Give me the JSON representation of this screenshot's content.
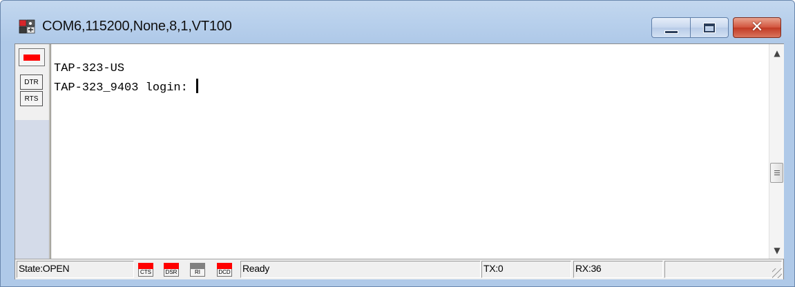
{
  "window": {
    "title": "COM6,115200,None,8,1,VT100",
    "icon": "serial-terminal-app-icon",
    "controls": {
      "minimize": "minimize-icon",
      "maximize": "maximize-icon",
      "close": "close-icon"
    }
  },
  "left_panel": {
    "lamp": {
      "color": "#ff0000"
    },
    "buttons": [
      "DTR",
      "RTS"
    ]
  },
  "terminal": {
    "lines": [
      "TAP-323-US",
      "TAP-323_9403 login: "
    ]
  },
  "status_bar": {
    "state": "State:OPEN",
    "indicators": [
      {
        "label": "CTS",
        "color": "#ff0000"
      },
      {
        "label": "DSR",
        "color": "#ff0000"
      },
      {
        "label": "RI",
        "color": "#808080"
      },
      {
        "label": "DCD",
        "color": "#ff0000"
      }
    ],
    "message": "Ready",
    "tx": "TX:0",
    "rx": "RX:36"
  },
  "colors": {
    "title_gradient": "#b8d0ec",
    "close_button": "#c13a24",
    "terminal_bg": "#ffffff",
    "signal_on": "#ff0000",
    "signal_off": "#808080"
  }
}
